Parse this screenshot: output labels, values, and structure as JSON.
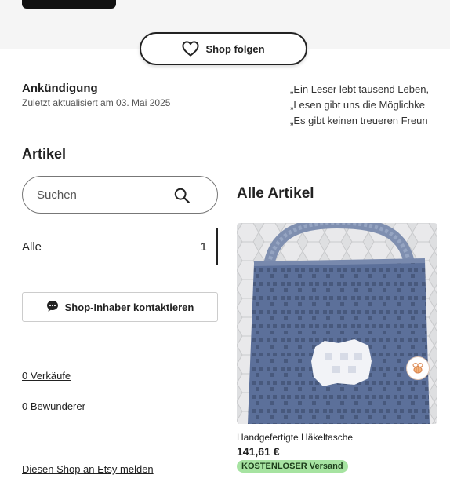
{
  "header": {
    "follow_button_label": "Shop folgen"
  },
  "announcement": {
    "title": "Ankündigung",
    "updated": "Zuletzt aktualisiert am 03. Mai 2025",
    "quotes": [
      "„Ein Leser lebt tausend Leben,",
      "„Lesen gibt uns die Möglichke",
      "„Es gibt keinen treueren Freun"
    ]
  },
  "sidebar": {
    "heading": "Artikel",
    "search_placeholder": "Suchen",
    "category": {
      "label": "Alle",
      "count": "1"
    },
    "contact_button_label": "Shop-Inhaber kontaktieren",
    "sales_link": "0 Verkäufe",
    "admirers": "0 Bewunderer",
    "report_link": "Diesen Shop an Etsy melden"
  },
  "main": {
    "heading": "Alle Artikel",
    "products": [
      {
        "title": "Handgefertigte Häkeltasche",
        "price": "141,61 €",
        "badge": "KOSTENLOSER Versand"
      }
    ]
  },
  "colors": {
    "shipping_badge_bg": "#a6e3a1",
    "bag_blue": "#5f739a",
    "text": "#222222"
  },
  "icons": {
    "follow": "heart-icon",
    "search": "search-icon",
    "contact": "chat-bubble-icon",
    "seller_badge": "bee-icon"
  }
}
